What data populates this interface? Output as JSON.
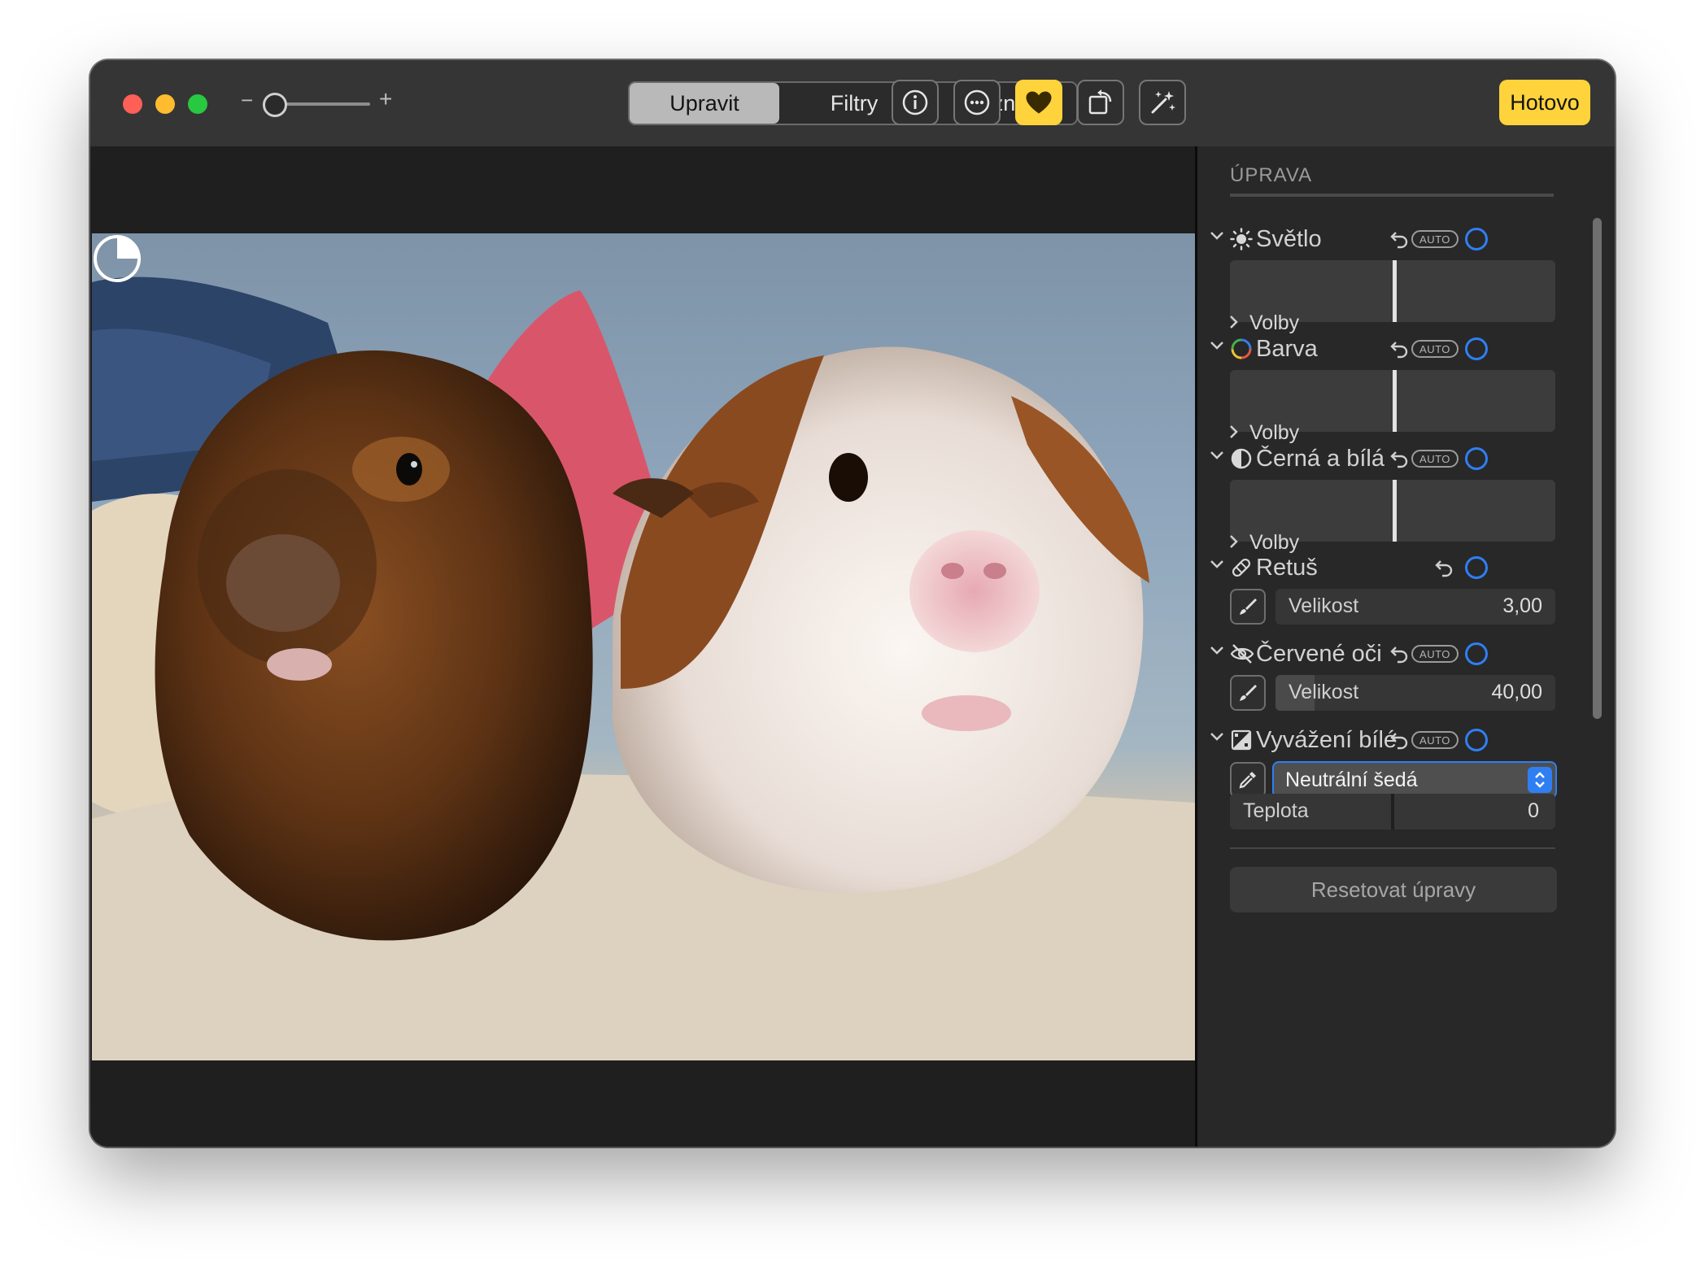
{
  "toolbar": {
    "zoom_minus": "−",
    "zoom_plus": "+",
    "zoom_level": 0.0,
    "tabs": [
      {
        "label": "Upravit",
        "active": true
      },
      {
        "label": "Filtry",
        "active": false
      },
      {
        "label": "Oříznout",
        "active": false
      }
    ],
    "icons": [
      "info-icon",
      "more-icon",
      "heart-icon",
      "rotate-icon",
      "magic-wand-icon"
    ],
    "done_label": "Hotovo",
    "accent": "#fed33b"
  },
  "sidebar": {
    "title": "ÚPRAVA",
    "auto_label": "AUTO",
    "options_label": "Volby",
    "sections": [
      {
        "label": "Světlo",
        "icon": "sun-icon"
      },
      {
        "label": "Barva",
        "icon": "color-ring-icon"
      },
      {
        "label": "Černá a bílá",
        "icon": "half-circle-icon"
      },
      {
        "label": "Retuš",
        "icon": "bandage-icon",
        "size_label": "Velikost",
        "size_value": "3,00",
        "size_fill": 0.0
      },
      {
        "label": "Červené oči",
        "icon": "eye-slash-icon",
        "size_label": "Velikost",
        "size_value": "40,00",
        "size_fill": 0.14
      },
      {
        "label": "Vyvážení bílé",
        "icon": "white-balance-icon",
        "select_value": "Neutrální šedá",
        "temp_label": "Teplota",
        "temp_value": "0"
      }
    ],
    "reset_label": "Resetovat úpravy",
    "accent_blue": "#2f7ff3"
  }
}
